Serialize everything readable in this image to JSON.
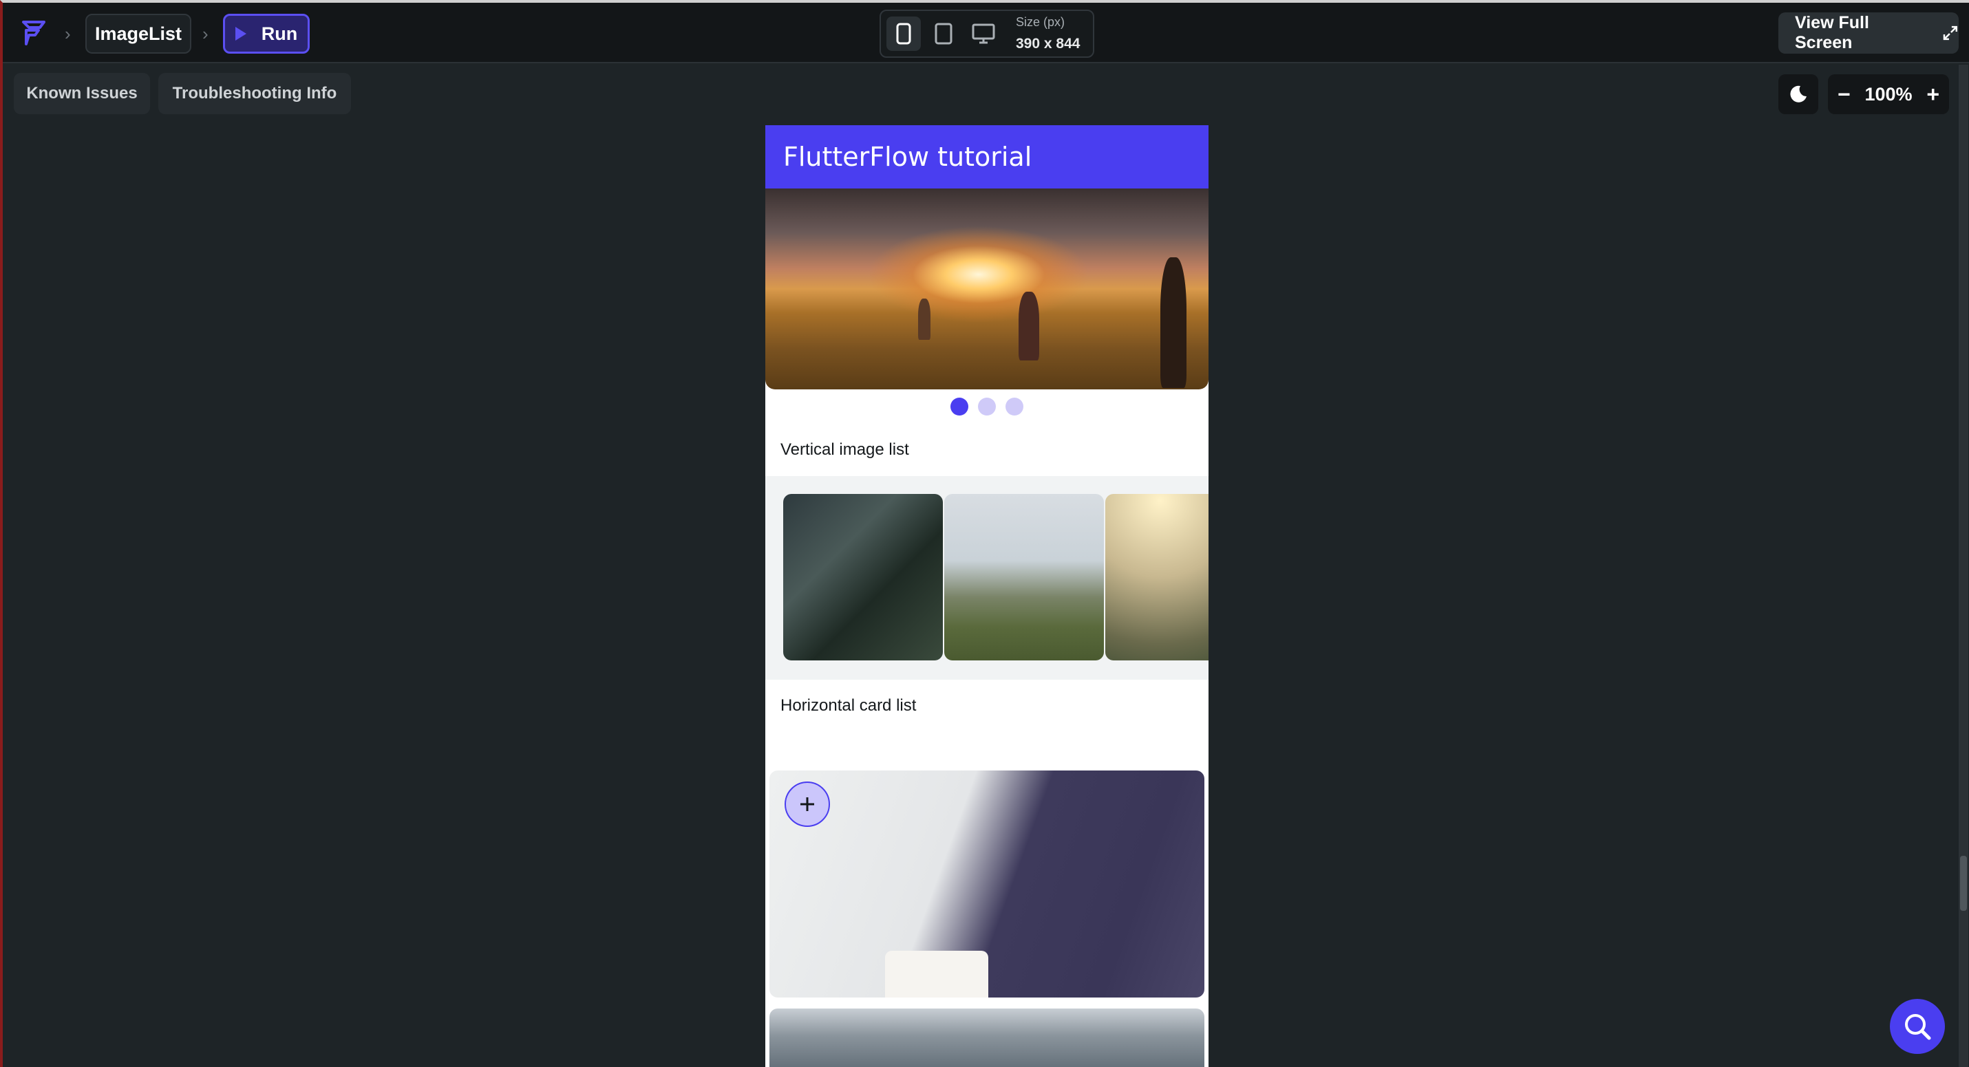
{
  "topbar": {
    "page_name": "ImageList",
    "run_label": "Run",
    "size_caption": "Size (px)",
    "size_value": "390 x 844",
    "fullscreen_label": "View Full Screen"
  },
  "toolbar": {
    "known_issues": "Known Issues",
    "troubleshooting": "Troubleshooting Info",
    "zoom": "100%"
  },
  "app": {
    "title": "FlutterFlow tutorial",
    "carousel_pages": 3,
    "carousel_active": 1,
    "section_vertical": "Vertical image list",
    "section_horizontal": "Horizontal card list"
  },
  "icons": [
    "flutterflow-logo-icon",
    "chevron-right-icon",
    "play-icon",
    "phone-icon",
    "tablet-icon",
    "desktop-icon",
    "expand-icon",
    "moon-icon",
    "minus-icon",
    "plus-icon",
    "add-icon",
    "search-icon"
  ],
  "colors": {
    "accent": "#4a3ef0",
    "background": "#1e2427",
    "topbar": "#131618"
  }
}
